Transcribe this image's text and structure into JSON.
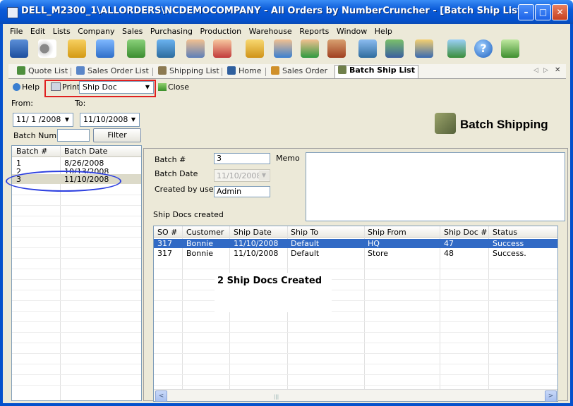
{
  "window": {
    "title": "DELL_M2300_1\\ALLORDERS\\NCDEMOCOMPANY - All Orders by NumberCruncher - [Batch Ship List]",
    "minimize": "–",
    "maximize": "□",
    "close": "✕"
  },
  "menu": [
    "File",
    "Edit",
    "Lists",
    "Company",
    "Sales",
    "Purchasing",
    "Production",
    "Warehouse",
    "Reports",
    "Window",
    "Help"
  ],
  "toolbar_icons": [
    "database-icon",
    "binoculars-icon",
    "box-check-icon",
    "user-check-icon",
    "user-check-icon",
    "users-icon",
    "user-check-icon",
    "person-paint-icon",
    "box-icon",
    "person-icon",
    "person-icon",
    "factory-icon",
    "users-icon",
    "users-icon",
    "user-hat-icon",
    "pen-check-icon",
    "help-icon",
    "exit-icon"
  ],
  "tabs": [
    {
      "label": "Quote List",
      "icon": "quote-icon"
    },
    {
      "label": "Sales Order List",
      "icon": "sales-order-list-icon"
    },
    {
      "label": "Shipping List",
      "icon": "shipping-list-icon"
    },
    {
      "label": "Home",
      "icon": "home-icon"
    },
    {
      "label": "Sales Order",
      "icon": "sales-order-icon"
    },
    {
      "label": "Batch Ship List",
      "icon": "batch-ship-icon"
    }
  ],
  "tab_controls": {
    "prev": "◁",
    "next": "▷",
    "close": "✕"
  },
  "subtoolbar": {
    "help": "Help",
    "print": "Print",
    "print_option": "Ship Doc",
    "close": "Close"
  },
  "filter": {
    "from_label": "From:",
    "to_label": "To:",
    "from_value": "11/ 1 /2008",
    "to_value": "11/10/2008",
    "batch_num_label": "Batch Num:",
    "batch_num_value": "",
    "filter_button": "Filter"
  },
  "heading": "Batch Shipping",
  "batch_list": {
    "columns": [
      "Batch #",
      "Batch Date"
    ],
    "rows": [
      [
        "1",
        "8/26/2008"
      ],
      [
        "2",
        "10/13/2008"
      ],
      [
        "3",
        "11/10/2008"
      ]
    ]
  },
  "detail": {
    "batch_label": "Batch #",
    "batch_value": "3",
    "date_label": "Batch Date",
    "date_value": "11/10/2008",
    "user_label": "Created by user",
    "user_value": "Admin",
    "memo_label": "Memo",
    "memo_value": "",
    "ship_docs_label": "Ship Docs created"
  },
  "ship_docs": {
    "columns": [
      "SO #",
      "Customer",
      "Ship Date",
      "Ship To",
      "Ship From",
      "Ship Doc #",
      "Status"
    ],
    "rows": [
      [
        "317",
        "Bonnie",
        "11/10/2008",
        "Default",
        "HQ",
        "47",
        "Success"
      ],
      [
        "317",
        "Bonnie",
        "11/10/2008",
        "Default",
        "Store",
        "48",
        "Success."
      ]
    ]
  },
  "annotation": "2 Ship Docs Created",
  "scroll": {
    "left": "<",
    "right": ">",
    "thumb": "|||"
  },
  "colors": {
    "titlebar": "#0451cc",
    "selection": "#316ac5",
    "highlight_box": "#e02020",
    "oval": "#2c3fe0"
  }
}
